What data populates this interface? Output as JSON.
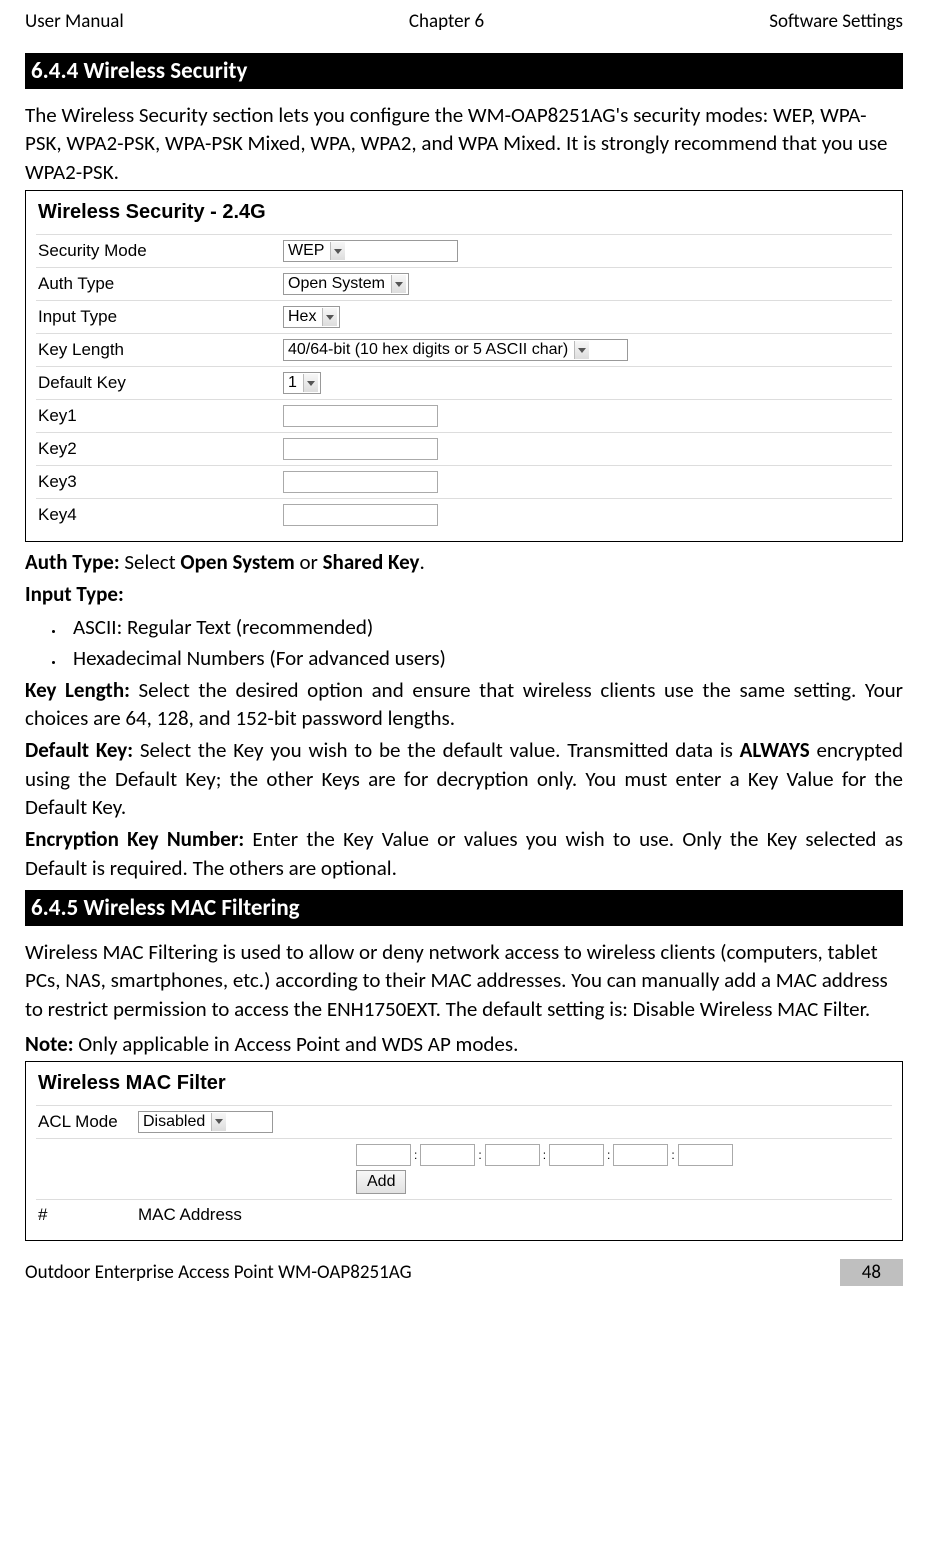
{
  "header": {
    "left": "User Manual",
    "center": "Chapter 6",
    "right": "Software Settings"
  },
  "sec1": {
    "heading": "6.4.4 Wireless Security",
    "intro": "The Wireless Security section lets you configure the WM-OAP8251AG's security modes: WEP, WPA-PSK, WPA2-PSK, WPA-PSK Mixed, WPA, WPA2, and WPA Mixed. It is strongly recommend that you use WPA2-PSK."
  },
  "ws_panel": {
    "title": "Wireless Security - 2.4G",
    "rows": {
      "security_mode": {
        "label": "Security Mode",
        "value": "WEP"
      },
      "auth_type": {
        "label": "Auth Type",
        "value": "Open System"
      },
      "input_type": {
        "label": "Input Type",
        "value": "Hex"
      },
      "key_length": {
        "label": "Key Length",
        "value": "40/64-bit (10 hex digits or 5 ASCII char)"
      },
      "default_key": {
        "label": "Default Key",
        "value": "1"
      },
      "key1": {
        "label": "Key1"
      },
      "key2": {
        "label": "Key2"
      },
      "key3": {
        "label": "Key3"
      },
      "key4": {
        "label": "Key4"
      }
    }
  },
  "desc": {
    "auth_type_label": "Auth Type:",
    "auth_type_text": " Select ",
    "auth_opt1": "Open System",
    "auth_or": " or ",
    "auth_opt2": "Shared Key",
    "auth_period": ".",
    "input_type_label": "Input Type:",
    "bullet1": "ASCII: Regular Text (recommended)",
    "bullet2": "Hexadecimal Numbers (For advanced users)",
    "key_length_label": "Key Length:",
    "key_length_text": " Select the desired option and ensure that wireless clients use the same setting. Your choices are 64, 128, and 152-bit password lengths.",
    "default_key_label": "Default Key:",
    "default_key_text1": " Select the Key you wish to be the default value. Transmitted data is ",
    "always": "ALWAYS",
    "default_key_text2": " encrypted using the Default Key; the other Keys are for decryption only. You must enter a Key Value for the Default Key.",
    "enc_key_label": "Encryption Key Number:",
    "enc_key_text": " Enter the Key Value or values you wish to use. Only the Key selected as Default is required. The others are optional."
  },
  "sec2": {
    "heading": "6.4.5 Wireless MAC Filtering",
    "intro": "Wireless MAC Filtering is used to allow or deny network access to wireless clients (computers, tablet PCs, NAS, smartphones, etc.) according to their MAC addresses. You can manually add a MAC address to restrict permission to access the ENH1750EXT. The default setting is: Disable Wireless MAC Filter.",
    "note_label": "Note:",
    "note_text": " Only applicable in Access Point and WDS AP modes."
  },
  "mac_panel": {
    "title": "Wireless MAC Filter",
    "acl_label": "ACL Mode",
    "acl_value": "Disabled",
    "add_btn": "Add",
    "hash": "#",
    "mac_col": "MAC Address"
  },
  "footer": {
    "left": "Outdoor Enterprise Access Point WM-OAP8251AG",
    "page": "48"
  }
}
